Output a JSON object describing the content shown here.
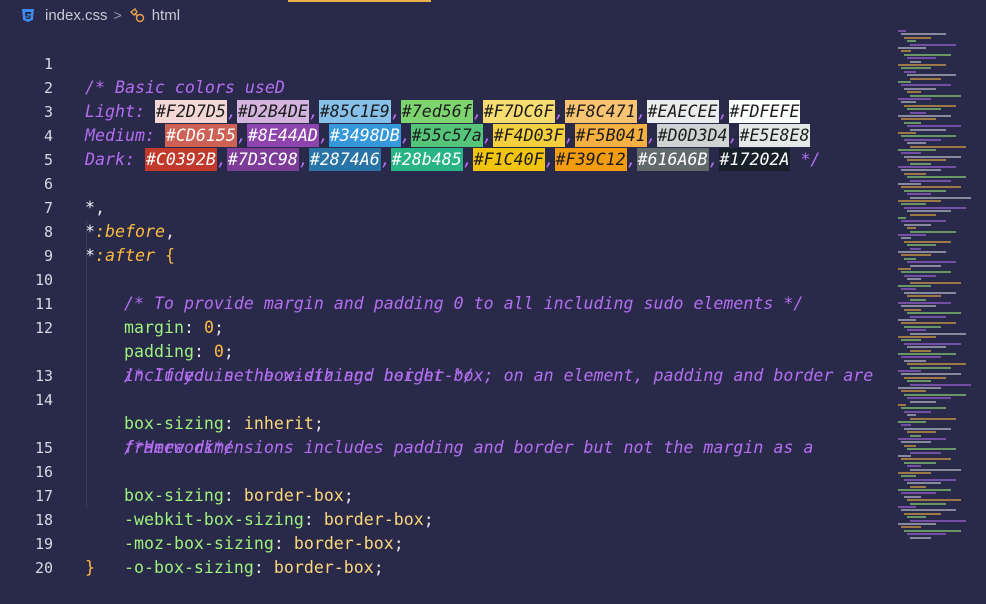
{
  "breadcrumb": {
    "file": "index.css",
    "symbol": "html",
    "separator": ">"
  },
  "colors": {
    "background": "#29294a",
    "comment": "#b46ef0",
    "property": "#9ef17c",
    "keyword": "#fbbb3f"
  },
  "lines": {
    "l1": {
      "num": "1",
      "text": "/* Basic colors useD"
    },
    "l2": {
      "num": "2",
      "label": "Light: ",
      "swatches": [
        "#F2D7D5",
        "#D2B4DE",
        "#85C1E9",
        "#7ed56f",
        "#F7DC6F",
        "#F8C471",
        "#EAECEE",
        "#FDFEFE"
      ]
    },
    "l3": {
      "num": "3",
      "label": "Medium: ",
      "swatches": [
        "#CD6155",
        "#8E44AD",
        "#3498DB",
        "#55c57a",
        "#F4D03F",
        "#F5B041",
        "#D0D3D4",
        "#E5E8E8"
      ]
    },
    "l4": {
      "num": "4",
      "label": "Dark: ",
      "swatches": [
        "#C0392B",
        "#7D3C98",
        "#2874A6",
        "#28b485",
        "#F1C40F",
        "#F39C12",
        "#616A6B",
        "#17202A"
      ],
      "end": " */"
    },
    "l5": {
      "num": "5"
    },
    "l6": {
      "num": "6",
      "sel": "*",
      "p": ","
    },
    "l7": {
      "num": "7",
      "sel": "*",
      "pseudo": ":before",
      "p": ","
    },
    "l8": {
      "num": "8",
      "sel": "*",
      "pseudo": ":after",
      "brace": " {"
    },
    "l9": {
      "num": "9",
      "comment": "/* To provide margin and padding 0 to all including sudo elements */"
    },
    "l10": {
      "num": "10",
      "prop": "margin",
      "colon": ": ",
      "value": "0",
      "semi": ";"
    },
    "l11": {
      "num": "11",
      "prop": "padding",
      "colon": ": ",
      "value": "0",
      "semi": ";"
    },
    "l12": {
      "num": "12",
      "comment": "/* If you set box-sizing: border-box; on an element, padding and border are"
    },
    "l12b": {
      "comment": "included in the width and height */"
    },
    "l13": {
      "num": "13",
      "prop": "box-sizing",
      "colon": ": ",
      "value": "inherit",
      "semi": ";"
    },
    "l14": {
      "num": "14",
      "comment": "/*Here dimensions includes padding and border but not the margin as a"
    },
    "l14b": {
      "comment": "framework*/"
    },
    "l15": {
      "num": "15",
      "prop": "box-sizing",
      "colon": ": ",
      "value": "border-box",
      "semi": ";"
    },
    "l16": {
      "num": "16",
      "prop": "-webkit-box-sizing",
      "colon": ": ",
      "value": "border-box",
      "semi": ";"
    },
    "l17": {
      "num": "17",
      "prop": "-moz-box-sizing",
      "colon": ": ",
      "value": "border-box",
      "semi": ";"
    },
    "l18": {
      "num": "18",
      "prop": "-o-box-sizing",
      "colon": ": ",
      "value": "border-box",
      "semi": ";"
    },
    "l19": {
      "num": "19",
      "brace": "}"
    },
    "l20": {
      "num": "20"
    }
  }
}
